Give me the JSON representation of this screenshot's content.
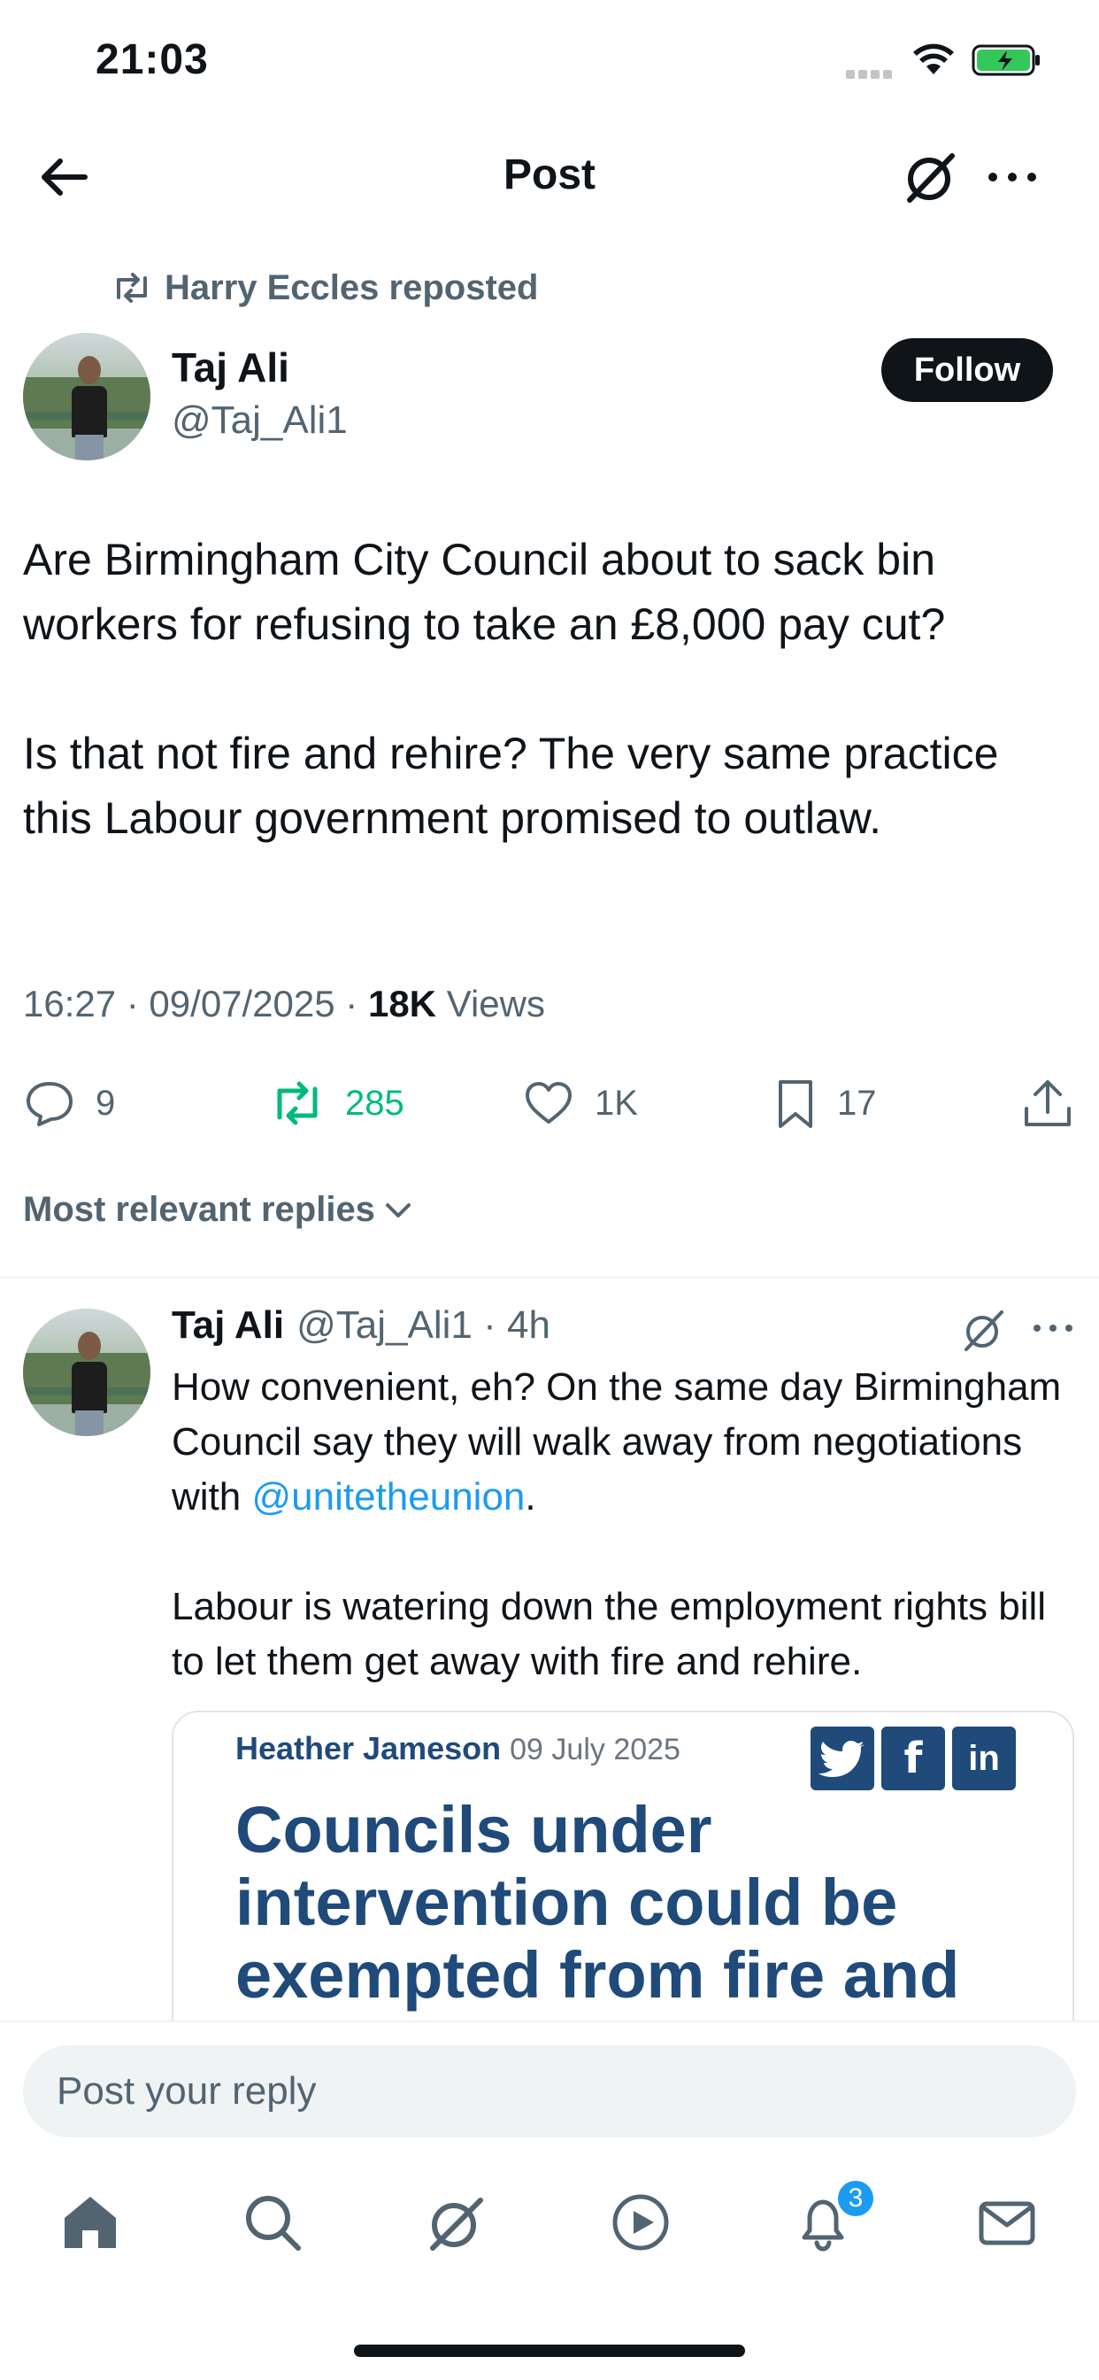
{
  "status_bar": {
    "time": "21:03"
  },
  "header": {
    "title": "Post"
  },
  "repost": {
    "text": "Harry Eccles reposted"
  },
  "post": {
    "author_name": "Taj Ali",
    "author_handle": "@Taj_Ali1",
    "follow_label": "Follow",
    "paragraphs": [
      "Are Birmingham City Council about to sack bin workers for refusing to take an £8,000 pay cut?",
      "Is that not fire and rehire? The very same practice this Labour government promised to outlaw."
    ],
    "timestamp": "16:27 · 09/07/2025 · ",
    "views_count": "18K",
    "views_label": " Views",
    "stats": {
      "replies": "9",
      "reposts": "285",
      "likes": "1K",
      "bookmarks": "17"
    }
  },
  "sort": {
    "label": "Most relevant replies"
  },
  "reply": {
    "author_name": "Taj Ali",
    "author_handle": "@Taj_Ali1 · 4h",
    "p1_before": "How convenient, eh? On the same day Birmingham Council say they will walk away from negotiations with ",
    "p1_mention": "@unitetheunion",
    "p1_after": ".",
    "p2": "Labour is watering down the employment rights bill to let them get away with fire and rehire.",
    "card": {
      "author": "Heather Jameson",
      "date": "09 July 2025",
      "headline": "Councils under intervention could be exempted from fire and rehire rules"
    }
  },
  "composer": {
    "placeholder": "Post your reply"
  },
  "nav": {
    "notifications_badge": "3"
  },
  "colors": {
    "accent": "#1d9bf0",
    "repost_green": "#00ba7c",
    "text": "#0f1419",
    "muted": "#536471",
    "card_blue": "#1f4a7a"
  }
}
